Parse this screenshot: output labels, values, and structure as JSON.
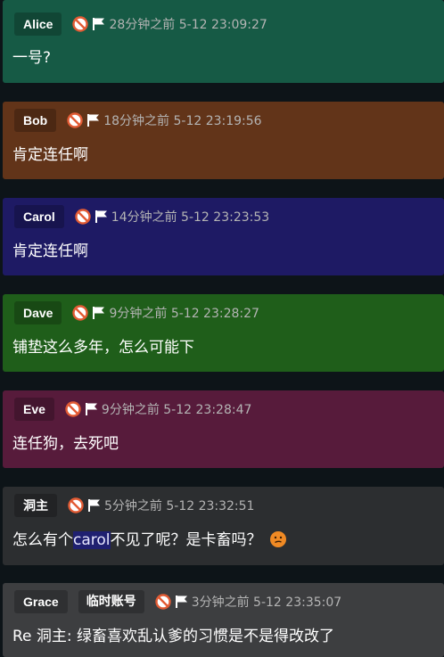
{
  "colors": {
    "page_bg": "#0d1418",
    "meta_text": "#b4b4b4",
    "highlight_bg": "#1f2070"
  },
  "comments": [
    {
      "author": "Alice",
      "time": "28分钟之前 5-12 23:09:27",
      "body": "一号?",
      "bg": "#165a45"
    },
    {
      "author": "Bob",
      "time": "18分钟之前 5-12 23:19:56",
      "body": "肯定连任啊",
      "bg": "#623419"
    },
    {
      "author": "Carol",
      "time": "14分钟之前 5-12 23:23:53",
      "body": "肯定连任啊",
      "bg": "#1e1a64"
    },
    {
      "author": "Dave",
      "time": "9分钟之前 5-12 23:28:27",
      "body": "铺垫这么多年，怎么可能下",
      "bg": "#1f5e1a"
    },
    {
      "author": "Eve",
      "time": "9分钟之前 5-12 23:28:47",
      "body": "连任狗，去死吧",
      "bg": "#571b3b"
    },
    {
      "author": "洞主",
      "time": "5分钟之前 5-12 23:32:51",
      "body_pre": "怎么有个",
      "body_hl": "carol",
      "body_post": "不见了呢？是卡畜吗？",
      "emoji": "thinking-face-icon",
      "bg": "#2c2e30"
    },
    {
      "author": "Grace",
      "tag": "临时账号",
      "time": "3分钟之前 5-12 23:35:07",
      "body": "Re 洞主: 绿畜喜欢乱认爹的习惯是不是得改改了",
      "bg": "#3d3e40"
    }
  ]
}
